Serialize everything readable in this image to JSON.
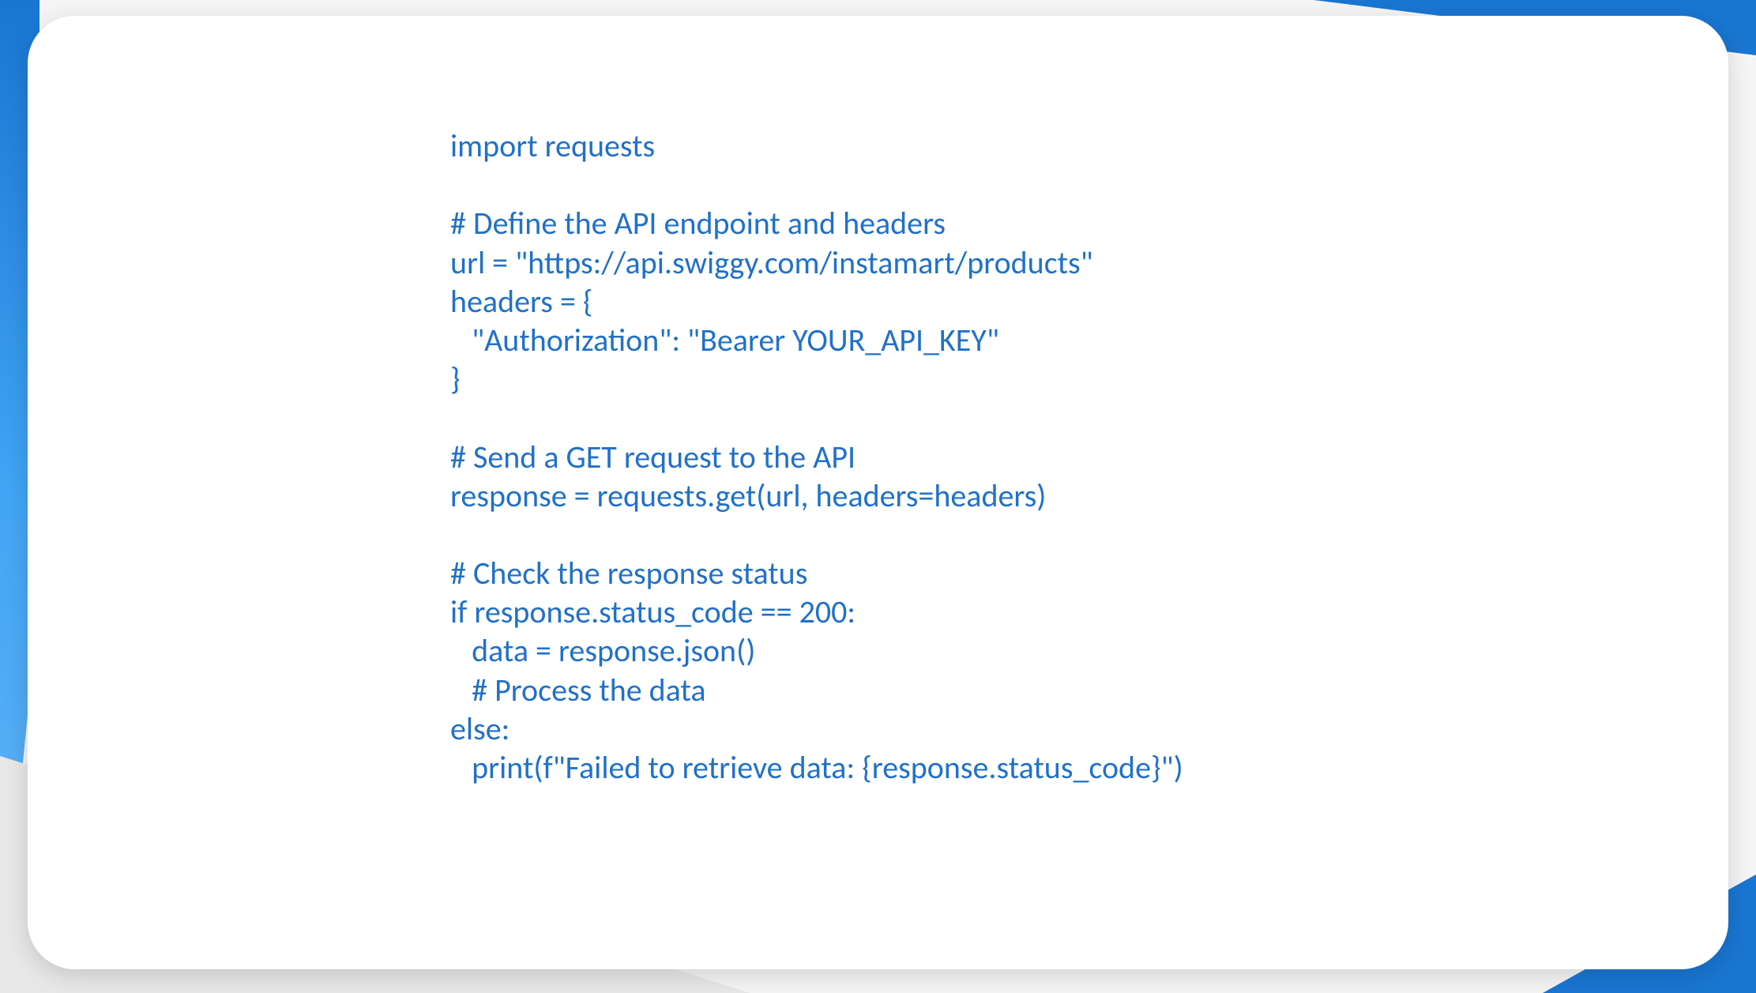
{
  "code": {
    "lines": [
      "import requests",
      "",
      "# Define the API endpoint and headers",
      "url = \"https://api.swiggy.com/instamart/products\"",
      "headers = {",
      "   \"Authorization\": \"Bearer YOUR_API_KEY\"",
      "}",
      "",
      "# Send a GET request to the API",
      "response = requests.get(url, headers=headers)",
      "",
      "# Check the response status",
      "if response.status_code == 200:",
      "   data = response.json()",
      "   # Process the data",
      "else:",
      "   print(f\"Failed to retrieve data: {response.status_code}\")"
    ]
  }
}
